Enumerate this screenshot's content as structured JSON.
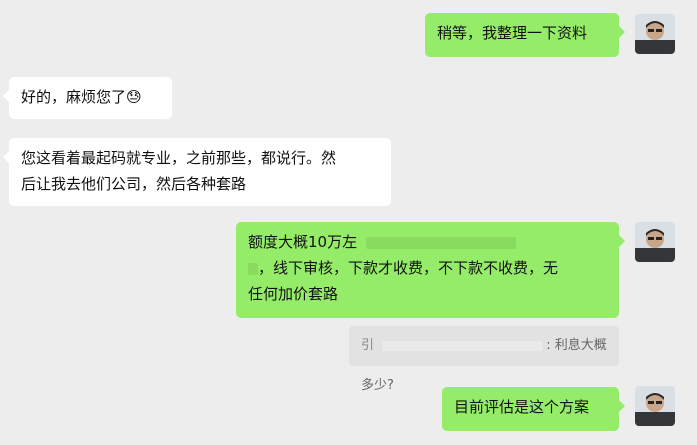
{
  "messages": {
    "m1": {
      "text": "稍等，我整理一下资料"
    },
    "m2": {
      "text": "好的，麻烦您了",
      "emoji": "😓"
    },
    "m3": {
      "line1": "您这看着最起码就专业，之前那些，都说行。然",
      "line2": "后让我去他们公司，然后各种套路"
    },
    "m4": {
      "line1": "额度大概10万左",
      "line2": "，线下审核，下款才收费，不下款不收费，无",
      "line3": "任何加价套路"
    },
    "m5": {
      "prefix": "引",
      "text": ": 利息大概多少?"
    },
    "m6": {
      "text": "目前评估是这个方案"
    }
  },
  "icons": {
    "avatar": "user-avatar-icon"
  },
  "colors": {
    "bg": "#ededed",
    "green": "#95ec69",
    "white": "#ffffff"
  }
}
